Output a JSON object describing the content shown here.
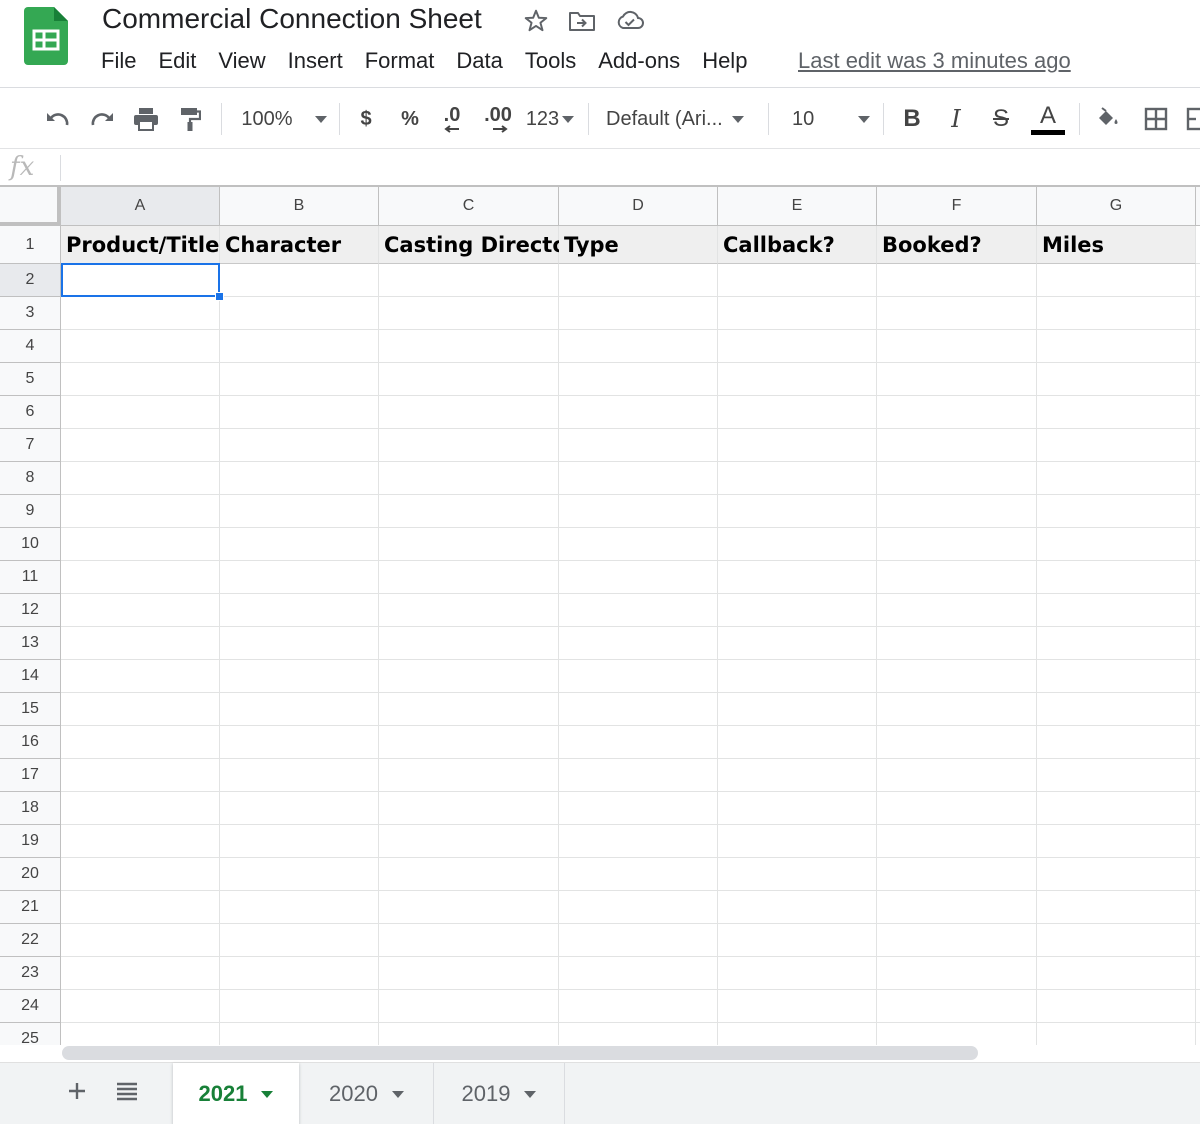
{
  "app": {
    "title": "Commercial Connection Sheet",
    "last_edit": "Last edit was 3 minutes ago",
    "brand_color": "#34a853",
    "accent_color": "#1a73e8",
    "tab_active_color": "#188038"
  },
  "menubar": [
    "File",
    "Edit",
    "View",
    "Insert",
    "Format",
    "Data",
    "Tools",
    "Add-ons",
    "Help"
  ],
  "toolbar": {
    "zoom": "100%",
    "currency": "$",
    "percent": "%",
    "decrease_decimal": ".0",
    "increase_decimal": ".00",
    "more_formats": "123",
    "font": "Default (Ari...",
    "font_size": "10",
    "bold": "B",
    "italic": "I",
    "strikethrough": "S",
    "text_color_letter": "A"
  },
  "formula_bar": {
    "label": "fx",
    "value": ""
  },
  "sheet": {
    "columns": [
      "A",
      "B",
      "C",
      "D",
      "E",
      "F",
      "G"
    ],
    "rows": [
      "1",
      "2",
      "3",
      "4",
      "5",
      "6",
      "7",
      "8",
      "9",
      "10",
      "11",
      "12",
      "13",
      "14",
      "15",
      "16",
      "17",
      "18",
      "19",
      "20",
      "21",
      "22",
      "23",
      "24",
      "25"
    ],
    "header_row": [
      "Product/Title",
      "Character",
      "Casting Director",
      "Type",
      "Callback?",
      "Booked?",
      "Miles"
    ],
    "active_cell": "A2"
  },
  "tabs": [
    "2021",
    "2020",
    "2019"
  ],
  "active_tab": "2021"
}
